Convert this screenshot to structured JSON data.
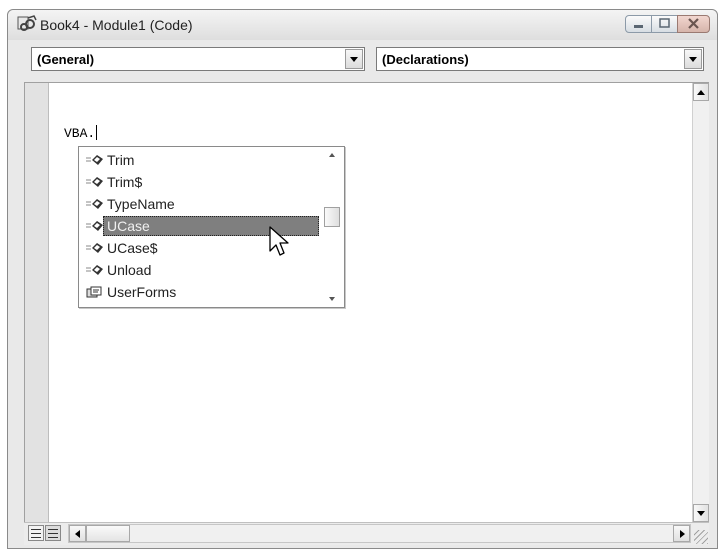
{
  "window": {
    "title": "Book4 - Module1 (Code)",
    "icon": "vba-code-module-icon",
    "buttons": [
      "minimize",
      "maximize",
      "close"
    ]
  },
  "object_combo": {
    "value": "(General)"
  },
  "procedure_combo": {
    "value": "(Declarations)"
  },
  "editor": {
    "code_text": "VBA."
  },
  "autocomplete": {
    "items": [
      {
        "label": "Trim",
        "icon": "method-icon",
        "selected": false
      },
      {
        "label": "Trim$",
        "icon": "method-icon",
        "selected": false
      },
      {
        "label": "TypeName",
        "icon": "method-icon",
        "selected": false
      },
      {
        "label": "UCase",
        "icon": "method-icon",
        "selected": true
      },
      {
        "label": "UCase$",
        "icon": "method-icon",
        "selected": false
      },
      {
        "label": "Unload",
        "icon": "method-icon",
        "selected": false
      },
      {
        "label": "UserForms",
        "icon": "property-icon",
        "selected": false
      }
    ]
  },
  "colors": {
    "selection": "#7f7f7f",
    "chrome": "#e9e9e9"
  }
}
